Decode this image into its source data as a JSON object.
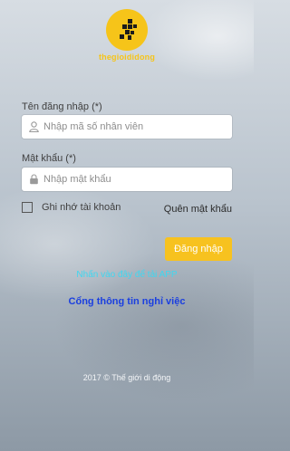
{
  "brand": {
    "logo_text": "thegioididong",
    "color": "#f6c419"
  },
  "form": {
    "username_label": "Tên đăng nhập (*)",
    "username_placeholder": "Nhập mã số nhân viên",
    "username_icon": "user-icon",
    "password_label": "Mật khẩu (*)",
    "password_placeholder": "Nhập mật khẩu",
    "password_icon": "lock-icon",
    "remember_label": "Ghi nhớ tài khoản",
    "remember_checked": false,
    "forgot_label": "Quên mật khẩu",
    "login_label": "Đăng nhập",
    "login_color": "#f7c21f"
  },
  "links": {
    "app_download": "Nhấn vào đây để tải APP",
    "leave_portal": "Cổng thông tin nghỉ việc"
  },
  "footer": {
    "copyright": "2017 © Thế giới di động"
  }
}
